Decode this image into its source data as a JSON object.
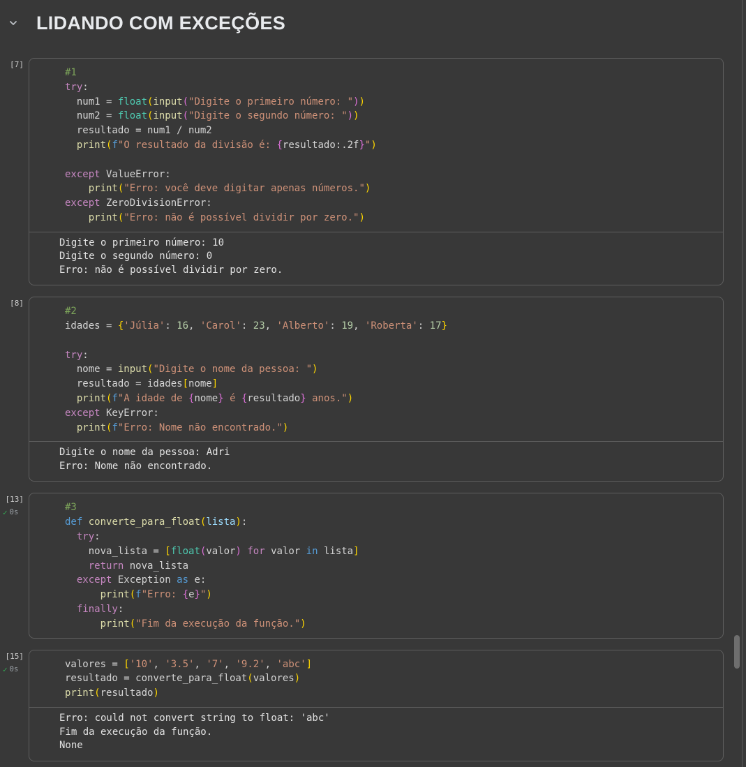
{
  "header": {
    "title": "LIDANDO COM EXCEÇÕES",
    "collapse_icon": "chevron-down"
  },
  "colors": {
    "bg": "#383838",
    "cellbg": "#383838",
    "border": "#5E5E5E",
    "ok": "#34A853",
    "cm": "#7DA55A",
    "kw": "#C586C0",
    "bl": "#569CD6",
    "ty": "#4EC9B0",
    "fn": "#DCDCAA",
    "st": "#CE9178",
    "nu": "#B5CEA8",
    "pl": "#D4D4D4",
    "pa": "#9CDCFE",
    "b1": "#FFD700",
    "b2": "#DA70D6"
  },
  "cells": [
    {
      "exec_label": "[7]",
      "timing": null,
      "code": [
        [
          {
            "c": "cm",
            "t": "#1"
          }
        ],
        [
          {
            "c": "kw",
            "t": "try"
          },
          {
            "c": "pl",
            "t": ":"
          }
        ],
        [
          {
            "c": "pl",
            "t": "  num1 = "
          },
          {
            "c": "ty",
            "t": "float"
          },
          {
            "c": "b1",
            "t": "("
          },
          {
            "c": "fn",
            "t": "input"
          },
          {
            "c": "b2",
            "t": "("
          },
          {
            "c": "st",
            "t": "\"Digite o primeiro número: \""
          },
          {
            "c": "b2",
            "t": ")"
          },
          {
            "c": "b1",
            "t": ")"
          }
        ],
        [
          {
            "c": "pl",
            "t": "  num2 = "
          },
          {
            "c": "ty",
            "t": "float"
          },
          {
            "c": "b1",
            "t": "("
          },
          {
            "c": "fn",
            "t": "input"
          },
          {
            "c": "b2",
            "t": "("
          },
          {
            "c": "st",
            "t": "\"Digite o segundo número: \""
          },
          {
            "c": "b2",
            "t": ")"
          },
          {
            "c": "b1",
            "t": ")"
          }
        ],
        [
          {
            "c": "pl",
            "t": "  resultado = num1 / num2"
          }
        ],
        [
          {
            "c": "pl",
            "t": "  "
          },
          {
            "c": "fn",
            "t": "print"
          },
          {
            "c": "b1",
            "t": "("
          },
          {
            "c": "bl",
            "t": "f"
          },
          {
            "c": "st",
            "t": "\"O resultado da divisão é: "
          },
          {
            "c": "b2",
            "t": "{"
          },
          {
            "c": "pl",
            "t": "resultado:.2f"
          },
          {
            "c": "b2",
            "t": "}"
          },
          {
            "c": "st",
            "t": "\""
          },
          {
            "c": "b1",
            "t": ")"
          }
        ],
        [],
        [
          {
            "c": "kw",
            "t": "except"
          },
          {
            "c": "pl",
            "t": " ValueError:"
          }
        ],
        [
          {
            "c": "pl",
            "t": "    "
          },
          {
            "c": "fn",
            "t": "print"
          },
          {
            "c": "b1",
            "t": "("
          },
          {
            "c": "st",
            "t": "\"Erro: você deve digitar apenas números.\""
          },
          {
            "c": "b1",
            "t": ")"
          }
        ],
        [
          {
            "c": "kw",
            "t": "except"
          },
          {
            "c": "pl",
            "t": " ZeroDivisionError:"
          }
        ],
        [
          {
            "c": "pl",
            "t": "    "
          },
          {
            "c": "fn",
            "t": "print"
          },
          {
            "c": "b1",
            "t": "("
          },
          {
            "c": "st",
            "t": "\"Erro: não é possível dividir por zero.\""
          },
          {
            "c": "b1",
            "t": ")"
          }
        ]
      ],
      "output": [
        "Digite o primeiro número: 10",
        "Digite o segundo número: 0",
        "Erro: não é possível dividir por zero."
      ]
    },
    {
      "exec_label": "[8]",
      "timing": null,
      "code": [
        [
          {
            "c": "cm",
            "t": "#2"
          }
        ],
        [
          {
            "c": "pl",
            "t": "idades = "
          },
          {
            "c": "b1",
            "t": "{"
          },
          {
            "c": "st",
            "t": "'Júlia'"
          },
          {
            "c": "pl",
            "t": ": "
          },
          {
            "c": "nu",
            "t": "16"
          },
          {
            "c": "pl",
            "t": ", "
          },
          {
            "c": "st",
            "t": "'Carol'"
          },
          {
            "c": "pl",
            "t": ": "
          },
          {
            "c": "nu",
            "t": "23"
          },
          {
            "c": "pl",
            "t": ", "
          },
          {
            "c": "st",
            "t": "'Alberto'"
          },
          {
            "c": "pl",
            "t": ": "
          },
          {
            "c": "nu",
            "t": "19"
          },
          {
            "c": "pl",
            "t": ", "
          },
          {
            "c": "st",
            "t": "'Roberta'"
          },
          {
            "c": "pl",
            "t": ": "
          },
          {
            "c": "nu",
            "t": "17"
          },
          {
            "c": "b1",
            "t": "}"
          }
        ],
        [],
        [
          {
            "c": "kw",
            "t": "try"
          },
          {
            "c": "pl",
            "t": ":"
          }
        ],
        [
          {
            "c": "pl",
            "t": "  nome = "
          },
          {
            "c": "fn",
            "t": "input"
          },
          {
            "c": "b1",
            "t": "("
          },
          {
            "c": "st",
            "t": "\"Digite o nome da pessoa: \""
          },
          {
            "c": "b1",
            "t": ")"
          }
        ],
        [
          {
            "c": "pl",
            "t": "  resultado = idades"
          },
          {
            "c": "b1",
            "t": "["
          },
          {
            "c": "pl",
            "t": "nome"
          },
          {
            "c": "b1",
            "t": "]"
          }
        ],
        [
          {
            "c": "pl",
            "t": "  "
          },
          {
            "c": "fn",
            "t": "print"
          },
          {
            "c": "b1",
            "t": "("
          },
          {
            "c": "bl",
            "t": "f"
          },
          {
            "c": "st",
            "t": "\"A idade de "
          },
          {
            "c": "b2",
            "t": "{"
          },
          {
            "c": "pl",
            "t": "nome"
          },
          {
            "c": "b2",
            "t": "}"
          },
          {
            "c": "st",
            "t": " é "
          },
          {
            "c": "b2",
            "t": "{"
          },
          {
            "c": "pl",
            "t": "resultado"
          },
          {
            "c": "b2",
            "t": "}"
          },
          {
            "c": "st",
            "t": " anos.\""
          },
          {
            "c": "b1",
            "t": ")"
          }
        ],
        [
          {
            "c": "kw",
            "t": "except"
          },
          {
            "c": "pl",
            "t": " KeyError:"
          }
        ],
        [
          {
            "c": "pl",
            "t": "  "
          },
          {
            "c": "fn",
            "t": "print"
          },
          {
            "c": "b1",
            "t": "("
          },
          {
            "c": "bl",
            "t": "f"
          },
          {
            "c": "st",
            "t": "\"Erro: Nome não encontrado.\""
          },
          {
            "c": "b1",
            "t": ")"
          }
        ]
      ],
      "output": [
        "Digite o nome da pessoa: Adri",
        "Erro: Nome não encontrado."
      ]
    },
    {
      "exec_label": "[13]",
      "timing": {
        "check": "✓",
        "secs": "0s"
      },
      "code": [
        [
          {
            "c": "cm",
            "t": "#3"
          }
        ],
        [
          {
            "c": "bl",
            "t": "def"
          },
          {
            "c": "pl",
            "t": " "
          },
          {
            "c": "fn",
            "t": "converte_para_float"
          },
          {
            "c": "b1",
            "t": "("
          },
          {
            "c": "pa",
            "t": "lista"
          },
          {
            "c": "b1",
            "t": ")"
          },
          {
            "c": "pl",
            "t": ":"
          }
        ],
        [
          {
            "c": "pl",
            "t": "  "
          },
          {
            "c": "kw",
            "t": "try"
          },
          {
            "c": "pl",
            "t": ":"
          }
        ],
        [
          {
            "c": "pl",
            "t": "    nova_lista = "
          },
          {
            "c": "b1",
            "t": "["
          },
          {
            "c": "ty",
            "t": "float"
          },
          {
            "c": "b2",
            "t": "("
          },
          {
            "c": "pl",
            "t": "valor"
          },
          {
            "c": "b2",
            "t": ")"
          },
          {
            "c": "pl",
            "t": " "
          },
          {
            "c": "kw",
            "t": "for"
          },
          {
            "c": "pl",
            "t": " valor "
          },
          {
            "c": "bl",
            "t": "in"
          },
          {
            "c": "pl",
            "t": " lista"
          },
          {
            "c": "b1",
            "t": "]"
          }
        ],
        [
          {
            "c": "pl",
            "t": "    "
          },
          {
            "c": "kw",
            "t": "return"
          },
          {
            "c": "pl",
            "t": " nova_lista"
          }
        ],
        [
          {
            "c": "pl",
            "t": "  "
          },
          {
            "c": "kw",
            "t": "except"
          },
          {
            "c": "pl",
            "t": " Exception "
          },
          {
            "c": "bl",
            "t": "as"
          },
          {
            "c": "pl",
            "t": " e:"
          }
        ],
        [
          {
            "c": "pl",
            "t": "      "
          },
          {
            "c": "fn",
            "t": "print"
          },
          {
            "c": "b1",
            "t": "("
          },
          {
            "c": "bl",
            "t": "f"
          },
          {
            "c": "st",
            "t": "\"Erro: "
          },
          {
            "c": "b2",
            "t": "{"
          },
          {
            "c": "pl",
            "t": "e"
          },
          {
            "c": "b2",
            "t": "}"
          },
          {
            "c": "st",
            "t": "\""
          },
          {
            "c": "b1",
            "t": ")"
          }
        ],
        [
          {
            "c": "pl",
            "t": "  "
          },
          {
            "c": "kw",
            "t": "finally"
          },
          {
            "c": "pl",
            "t": ":"
          }
        ],
        [
          {
            "c": "pl",
            "t": "      "
          },
          {
            "c": "fn",
            "t": "print"
          },
          {
            "c": "b1",
            "t": "("
          },
          {
            "c": "st",
            "t": "\"Fim da execução da função.\""
          },
          {
            "c": "b1",
            "t": ")"
          }
        ]
      ],
      "output": null
    },
    {
      "exec_label": "[15]",
      "timing": {
        "check": "✓",
        "secs": "0s"
      },
      "code": [
        [
          {
            "c": "pl",
            "t": "valores = "
          },
          {
            "c": "b1",
            "t": "["
          },
          {
            "c": "st",
            "t": "'10'"
          },
          {
            "c": "pl",
            "t": ", "
          },
          {
            "c": "st",
            "t": "'3.5'"
          },
          {
            "c": "pl",
            "t": ", "
          },
          {
            "c": "st",
            "t": "'7'"
          },
          {
            "c": "pl",
            "t": ", "
          },
          {
            "c": "st",
            "t": "'9.2'"
          },
          {
            "c": "pl",
            "t": ", "
          },
          {
            "c": "st",
            "t": "'abc'"
          },
          {
            "c": "b1",
            "t": "]"
          }
        ],
        [
          {
            "c": "pl",
            "t": "resultado = converte_para_float"
          },
          {
            "c": "b1",
            "t": "("
          },
          {
            "c": "pl",
            "t": "valores"
          },
          {
            "c": "b1",
            "t": ")"
          }
        ],
        [
          {
            "c": "fn",
            "t": "print"
          },
          {
            "c": "b1",
            "t": "("
          },
          {
            "c": "pl",
            "t": "resultado"
          },
          {
            "c": "b1",
            "t": ")"
          }
        ]
      ],
      "output": [
        "Erro: could not convert string to float: 'abc'",
        "Fim da execução da função.",
        "None"
      ]
    }
  ]
}
